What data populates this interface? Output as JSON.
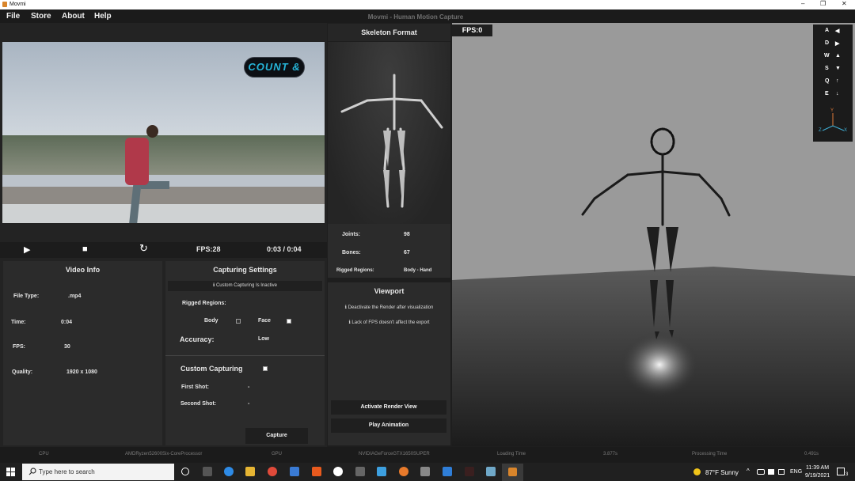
{
  "window": {
    "title": "Movmi",
    "min": "–",
    "max": "❐",
    "close": "✕"
  },
  "menu": {
    "file": "File",
    "store": "Store",
    "about": "About",
    "help": "Help"
  },
  "app_title": "Movmi - Human Motion Capture",
  "video": {
    "overlay": "COUNT &"
  },
  "controls": {
    "play": "▶",
    "stop": "■",
    "replay": "↻",
    "fps": "FPS:28",
    "time": "0:03 / 0:04"
  },
  "video_info": {
    "title": "Video Info",
    "rows": [
      {
        "label": "File Type:",
        "value": ".mp4"
      },
      {
        "label": "Time:",
        "value": "0:04"
      },
      {
        "label": "FPS:",
        "value": "30"
      },
      {
        "label": "Quality:",
        "value": "1920 x 1080"
      }
    ]
  },
  "capture": {
    "title": "Capturing Settings",
    "status": "ℹ Custom Capturing Is Inactive",
    "rigged_label": "Rigged Regions:",
    "body": "Body",
    "face": "Face",
    "accuracy_label": "Accuracy:",
    "accuracy_value": "Low",
    "custom_label": "Custom Capturing",
    "first_shot": "First Shot:",
    "first_val": "-",
    "second_shot": "Second Shot:",
    "second_val": "-",
    "capture_btn": "Capture"
  },
  "skeleton": {
    "title": "Skeleton Format",
    "joints_label": "Joints:",
    "joints": "98",
    "bones_label": "Bones:",
    "bones": "67",
    "rigged_label": "Rigged Regions:",
    "rigged": "Body - Hand"
  },
  "viewport": {
    "title": "Viewport",
    "note1": "ℹ Deactivate the Render after visualization",
    "note2": "ℹ Lack of FPS doesn't affect the export",
    "activate_btn": "Activate Render View",
    "play_btn": "Play Animation"
  },
  "view3d": {
    "fps": "FPS:0",
    "keys": [
      {
        "k": "A",
        "a": "◀"
      },
      {
        "k": "D",
        "a": "▶"
      },
      {
        "k": "W",
        "a": "▲"
      },
      {
        "k": "S",
        "a": "▼"
      },
      {
        "k": "Q",
        "a": "↑"
      },
      {
        "k": "E",
        "a": "↓"
      }
    ],
    "axis": {
      "y": "Y",
      "x": "X",
      "z": "Z"
    }
  },
  "status": {
    "cpu_label": "CPU",
    "cpu": "AMDRyzen52600Six-CoreProcessor",
    "gpu_label": "GPU",
    "gpu": "NVIDIAGeForceGTX1650SUPER",
    "load_label": "Loading Time",
    "load": "3.877s",
    "proc_label": "Processing Time",
    "proc": "0.491s"
  },
  "taskbar": {
    "search": "Type here to search",
    "weather": "87°F  Sunny",
    "lang": "ENG",
    "time": "11:39 AM",
    "date": "9/19/2021",
    "notif": "3"
  },
  "colors": {
    "accent": "#26b4d8",
    "panel": "#2b2b2b"
  }
}
